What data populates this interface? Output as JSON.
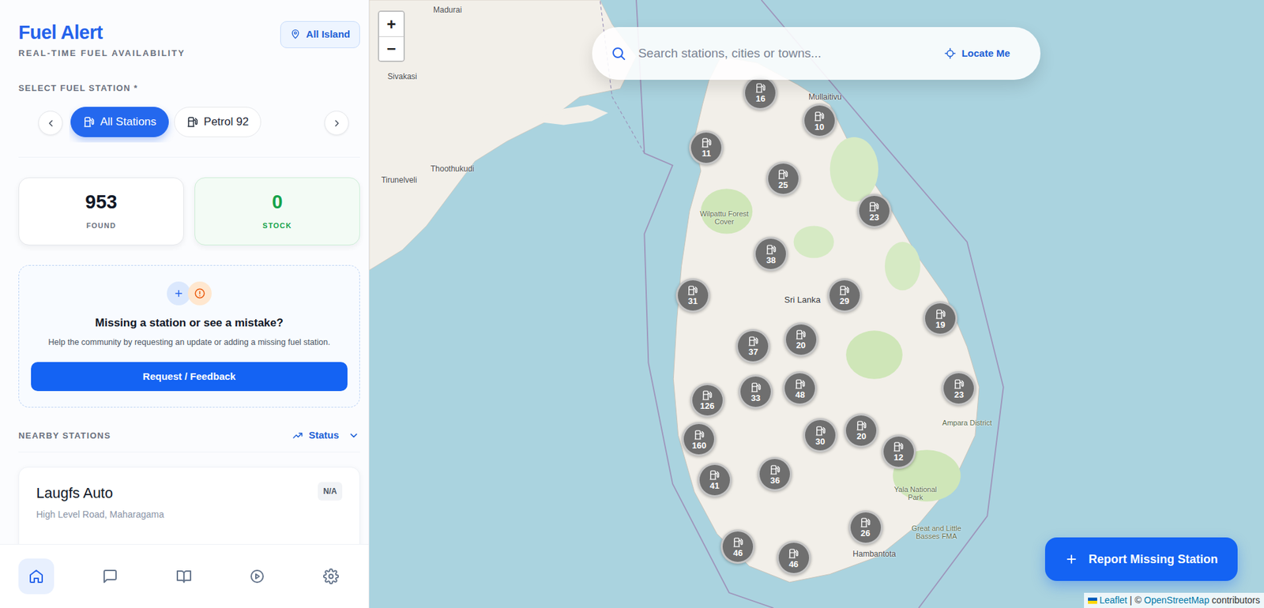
{
  "app": {
    "title": "Fuel Alert",
    "subtitle": "REAL-TIME FUEL AVAILABILITY",
    "region_button": "All Island"
  },
  "fuel_filter": {
    "label": "SELECT FUEL STATION *",
    "chips": [
      {
        "label": "All Stations",
        "selected": true
      },
      {
        "label": "Petrol 92",
        "selected": false
      }
    ]
  },
  "stats": [
    {
      "value": "953",
      "label": "FOUND",
      "kind": "count"
    },
    {
      "value": "0",
      "label": "STOCK",
      "kind": "stock"
    }
  ],
  "feedback": {
    "title": "Missing a station or see a mistake?",
    "description": "Help the community by requesting an update or adding a missing fuel station.",
    "button": "Request / Feedback"
  },
  "nearby": {
    "label": "NEARBY STATIONS",
    "sort": "Status",
    "stations": [
      {
        "name": "Laugfs Auto",
        "address": "High Level Road, Maharagama",
        "status": "N/A"
      }
    ]
  },
  "bottom_nav": [
    {
      "selected": true
    },
    {
      "selected": false
    },
    {
      "selected": false
    },
    {
      "selected": false
    },
    {
      "selected": false
    }
  ],
  "map": {
    "search": {
      "placeholder": "Search stations, cities or towns...",
      "locate_button": "Locate Me"
    },
    "zoom_in": "+",
    "zoom_out": "−",
    "clusters": [
      {
        "count": "16"
      },
      {
        "count": "10"
      },
      {
        "count": "11"
      },
      {
        "count": "25"
      },
      {
        "count": "23"
      },
      {
        "count": "38"
      },
      {
        "count": "31"
      },
      {
        "count": "29"
      },
      {
        "count": "19"
      },
      {
        "count": "37"
      },
      {
        "count": "20"
      },
      {
        "count": "33"
      },
      {
        "count": "48"
      },
      {
        "count": "23"
      },
      {
        "count": "126"
      },
      {
        "count": "160"
      },
      {
        "count": "30"
      },
      {
        "count": "20"
      },
      {
        "count": "12"
      },
      {
        "count": "41"
      },
      {
        "count": "36"
      },
      {
        "count": "26"
      },
      {
        "count": "46"
      },
      {
        "count": "46"
      }
    ],
    "labels": [
      "Madurai",
      "Sivakasi",
      "Thoothukudi",
      "Tirunelveli",
      "Mullaitivu",
      "Wilpattu Forest Cover",
      "Sri Lanka",
      "Ampara District",
      "Yala National Park",
      "Great and Little Basses FMA",
      "Hambantota"
    ],
    "report_button": "Report Missing Station",
    "attribution": {
      "leaflet": "Leaflet",
      "separator": " | © ",
      "osm": "OpenStreetMap",
      "suffix": " contributors"
    }
  }
}
